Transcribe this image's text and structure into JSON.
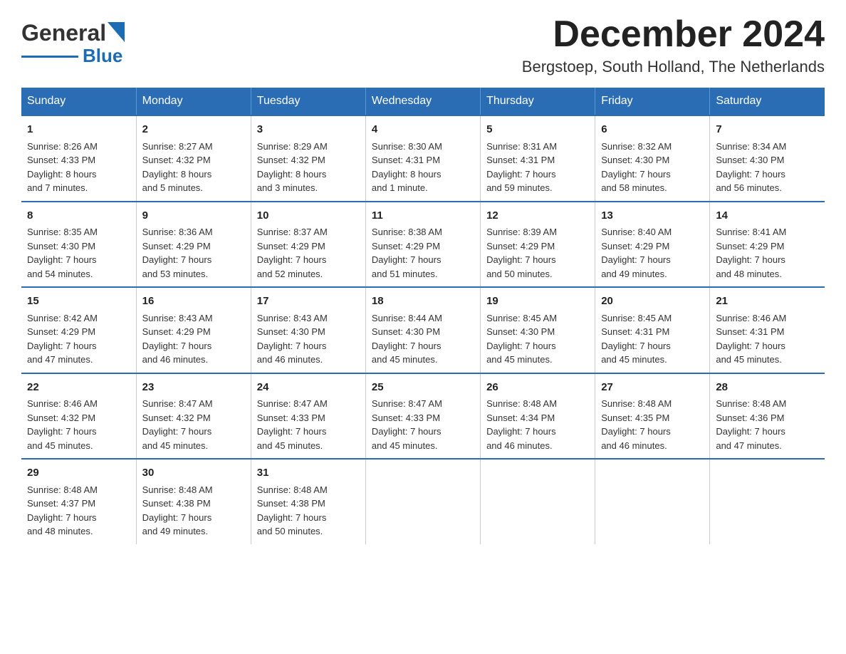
{
  "header": {
    "logo_text_general": "General",
    "logo_text_blue": "Blue",
    "month_title": "December 2024",
    "location": "Bergstoep, South Holland, The Netherlands"
  },
  "days_of_week": [
    "Sunday",
    "Monday",
    "Tuesday",
    "Wednesday",
    "Thursday",
    "Friday",
    "Saturday"
  ],
  "weeks": [
    [
      {
        "day": "1",
        "sunrise": "8:26 AM",
        "sunset": "4:33 PM",
        "daylight": "8 hours and 7 minutes."
      },
      {
        "day": "2",
        "sunrise": "8:27 AM",
        "sunset": "4:32 PM",
        "daylight": "8 hours and 5 minutes."
      },
      {
        "day": "3",
        "sunrise": "8:29 AM",
        "sunset": "4:32 PM",
        "daylight": "8 hours and 3 minutes."
      },
      {
        "day": "4",
        "sunrise": "8:30 AM",
        "sunset": "4:31 PM",
        "daylight": "8 hours and 1 minute."
      },
      {
        "day": "5",
        "sunrise": "8:31 AM",
        "sunset": "4:31 PM",
        "daylight": "7 hours and 59 minutes."
      },
      {
        "day": "6",
        "sunrise": "8:32 AM",
        "sunset": "4:30 PM",
        "daylight": "7 hours and 58 minutes."
      },
      {
        "day": "7",
        "sunrise": "8:34 AM",
        "sunset": "4:30 PM",
        "daylight": "7 hours and 56 minutes."
      }
    ],
    [
      {
        "day": "8",
        "sunrise": "8:35 AM",
        "sunset": "4:30 PM",
        "daylight": "7 hours and 54 minutes."
      },
      {
        "day": "9",
        "sunrise": "8:36 AM",
        "sunset": "4:29 PM",
        "daylight": "7 hours and 53 minutes."
      },
      {
        "day": "10",
        "sunrise": "8:37 AM",
        "sunset": "4:29 PM",
        "daylight": "7 hours and 52 minutes."
      },
      {
        "day": "11",
        "sunrise": "8:38 AM",
        "sunset": "4:29 PM",
        "daylight": "7 hours and 51 minutes."
      },
      {
        "day": "12",
        "sunrise": "8:39 AM",
        "sunset": "4:29 PM",
        "daylight": "7 hours and 50 minutes."
      },
      {
        "day": "13",
        "sunrise": "8:40 AM",
        "sunset": "4:29 PM",
        "daylight": "7 hours and 49 minutes."
      },
      {
        "day": "14",
        "sunrise": "8:41 AM",
        "sunset": "4:29 PM",
        "daylight": "7 hours and 48 minutes."
      }
    ],
    [
      {
        "day": "15",
        "sunrise": "8:42 AM",
        "sunset": "4:29 PM",
        "daylight": "7 hours and 47 minutes."
      },
      {
        "day": "16",
        "sunrise": "8:43 AM",
        "sunset": "4:29 PM",
        "daylight": "7 hours and 46 minutes."
      },
      {
        "day": "17",
        "sunrise": "8:43 AM",
        "sunset": "4:30 PM",
        "daylight": "7 hours and 46 minutes."
      },
      {
        "day": "18",
        "sunrise": "8:44 AM",
        "sunset": "4:30 PM",
        "daylight": "7 hours and 45 minutes."
      },
      {
        "day": "19",
        "sunrise": "8:45 AM",
        "sunset": "4:30 PM",
        "daylight": "7 hours and 45 minutes."
      },
      {
        "day": "20",
        "sunrise": "8:45 AM",
        "sunset": "4:31 PM",
        "daylight": "7 hours and 45 minutes."
      },
      {
        "day": "21",
        "sunrise": "8:46 AM",
        "sunset": "4:31 PM",
        "daylight": "7 hours and 45 minutes."
      }
    ],
    [
      {
        "day": "22",
        "sunrise": "8:46 AM",
        "sunset": "4:32 PM",
        "daylight": "7 hours and 45 minutes."
      },
      {
        "day": "23",
        "sunrise": "8:47 AM",
        "sunset": "4:32 PM",
        "daylight": "7 hours and 45 minutes."
      },
      {
        "day": "24",
        "sunrise": "8:47 AM",
        "sunset": "4:33 PM",
        "daylight": "7 hours and 45 minutes."
      },
      {
        "day": "25",
        "sunrise": "8:47 AM",
        "sunset": "4:33 PM",
        "daylight": "7 hours and 45 minutes."
      },
      {
        "day": "26",
        "sunrise": "8:48 AM",
        "sunset": "4:34 PM",
        "daylight": "7 hours and 46 minutes."
      },
      {
        "day": "27",
        "sunrise": "8:48 AM",
        "sunset": "4:35 PM",
        "daylight": "7 hours and 46 minutes."
      },
      {
        "day": "28",
        "sunrise": "8:48 AM",
        "sunset": "4:36 PM",
        "daylight": "7 hours and 47 minutes."
      }
    ],
    [
      {
        "day": "29",
        "sunrise": "8:48 AM",
        "sunset": "4:37 PM",
        "daylight": "7 hours and 48 minutes."
      },
      {
        "day": "30",
        "sunrise": "8:48 AM",
        "sunset": "4:38 PM",
        "daylight": "7 hours and 49 minutes."
      },
      {
        "day": "31",
        "sunrise": "8:48 AM",
        "sunset": "4:38 PM",
        "daylight": "7 hours and 50 minutes."
      },
      null,
      null,
      null,
      null
    ]
  ],
  "labels": {
    "sunrise": "Sunrise:",
    "sunset": "Sunset:",
    "daylight": "Daylight:"
  }
}
